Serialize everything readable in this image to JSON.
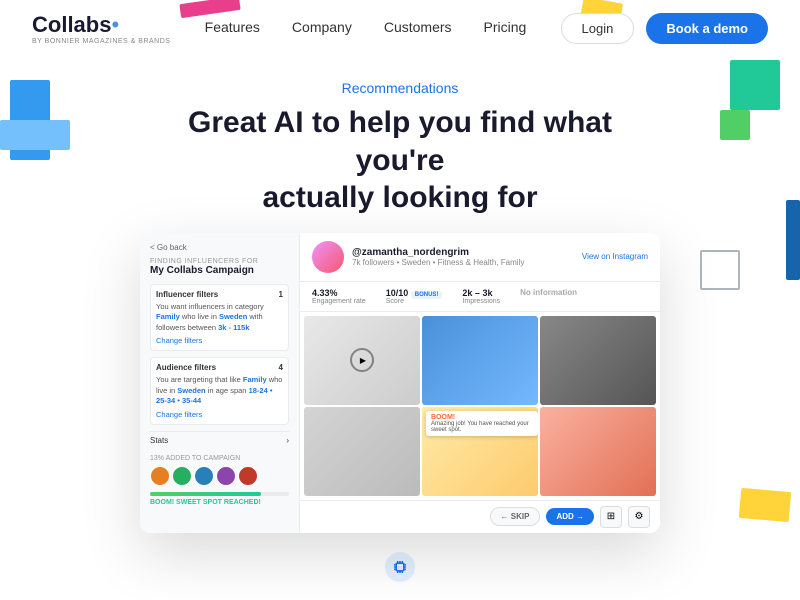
{
  "nav": {
    "logo": "Collabs",
    "logo_dot": "•",
    "logo_sub": "BY BONNIER MAGAZINES & BRANDS",
    "links": [
      "Features",
      "Company",
      "Customers",
      "Pricing"
    ],
    "login": "Login",
    "book_demo": "Book a demo"
  },
  "hero": {
    "tag": "Recommendations",
    "title_line1": "Great AI to help you find what you're",
    "title_line2": "actually looking for"
  },
  "mockup": {
    "back": "< Go back",
    "finding_label": "FINDING INFLUENCERS FOR",
    "campaign_name": "My Collabs Campaign",
    "influencer_filters_label": "Influencer filters",
    "influencer_filters_count": "1",
    "influencer_body": "You want influencers in category Family who live in Sweden with followers between 3k - 115k",
    "change_filters": "Change filters",
    "audience_filters_label": "Audience filters",
    "audience_filters_count": "4",
    "audience_body": "You are targeting that like Family who live in Sweden in age span 18-24 • 25-34 • 35-44",
    "stats_label": "Stats",
    "added_label": "13% ADDED TO CAMPAIGN",
    "boom_message": "BOOM! SWEET SPOT REACHED!",
    "profile_name": "@zamantha_nordengrim",
    "profile_meta": "7k followers  •  Sweden  •  Fitness & Health, Family",
    "view_instagram": "View on Instagram",
    "engagement": "4.33%",
    "engagement_label": "Engagement rate",
    "score": "10/10",
    "score_label": "Score",
    "score_badge": "BONUS!",
    "impressions": "2k – 3k",
    "impressions_label": "Impressions",
    "no_info": "No information",
    "boom_overlay": "BOOM!",
    "boom_sub": "Amazing job! You have reached your sweet spot.",
    "btn_skip": "← SKIP",
    "btn_add": "ADD →",
    "bottom_icon": "chip-icon"
  }
}
